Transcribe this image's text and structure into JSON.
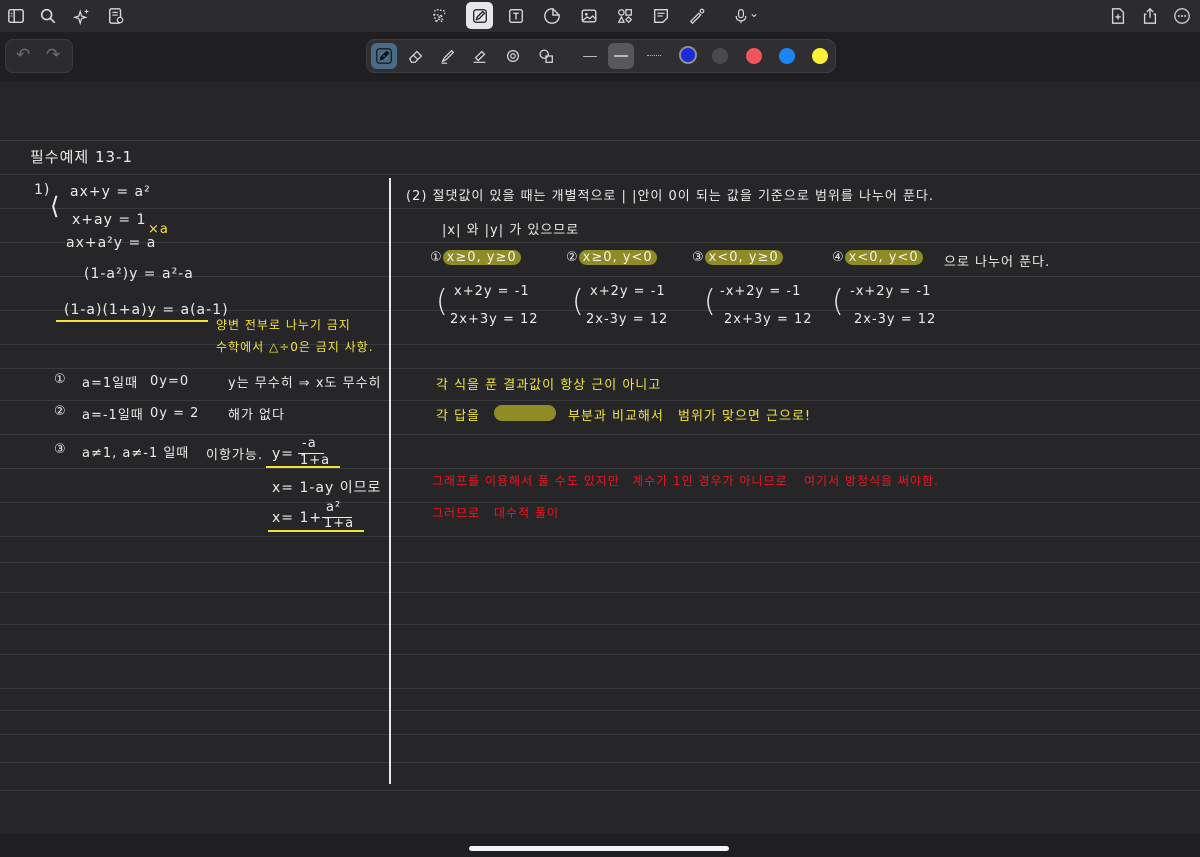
{
  "toolbar": {
    "left_icons": [
      "sidebar-icon",
      "search-icon",
      "sparkle-icon",
      "document-settings-icon"
    ],
    "center_icons": [
      "lasso-icon",
      "pen-icon",
      "text-box-icon",
      "sticker-icon",
      "image-icon",
      "shapes-icon",
      "sticky-note-icon",
      "laser-pointer-icon",
      "microphone-icon"
    ],
    "right_icons": [
      "add-page-icon",
      "share-icon",
      "more-icon"
    ],
    "mic_chevron": "⌄"
  },
  "undo": {
    "undo_glyph": "↶",
    "redo_glyph": "↷"
  },
  "pen_tools": {
    "items": [
      "fountain-pen-icon",
      "eraser-icon",
      "highlighter-icon",
      "marker-icon",
      "spot-icon",
      "shape-eraser-icon"
    ],
    "colors": [
      "#1a2bd8",
      "#4a4a4c",
      "#f0555a",
      "#1a86f5",
      "#fbef3a"
    ]
  },
  "note": {
    "title": "필수예제 13-1",
    "left": {
      "label_1": "1)",
      "eq1": "ax+y = a²",
      "eq2": "x+ay = 1",
      "times_a": "×a",
      "eq3": "ax+a²y = a",
      "eq4": "(1-a²)y = a²-a",
      "eq5": "(1-a)(1+a)y = a(a-1)",
      "note1": "양변 전부로 나누기 금지",
      "note2": "수학에서 △÷0은 금지 사항.",
      "case1_num": "①",
      "case1": "a=1일때",
      "case1_b": "0y=0",
      "case1_c": "y는 무수히 ⇒ x도 무수히",
      "case2_num": "②",
      "case2": "a=-1일때",
      "case2_b": "0y = 2",
      "case2_c": "해가 없다",
      "case3_num": "③",
      "case3": "a≠1, a≠-1 일때",
      "case3_b": "이항가능.",
      "sol_y_lhs": "y=",
      "sol_y_num": "-a",
      "sol_y_den": "1+a",
      "sol_x1": "x= 1-ay 이므로",
      "sol_x2_lhs": "x= 1+",
      "sol_x2_num": "a²",
      "sol_x2_den": "1+a"
    },
    "right": {
      "line1": "(2) 절댓값이 있을 때는 개별적으로 | |안이 0이 되는 값을 기준으로 범위를 나누어 푼다.",
      "line2": "|x| 와 |y| 가 있으므로",
      "case_labels": [
        {
          "num": "①",
          "cond": "x≥0, y≥0"
        },
        {
          "num": "②",
          "cond": "x≥0, y<0"
        },
        {
          "num": "③",
          "cond": "x<0, y≥0"
        },
        {
          "num": "④",
          "cond": "x<0, y<0"
        }
      ],
      "case_tail": "으로 나누어 푼다.",
      "systems": [
        {
          "a": "x+2y = -1",
          "b": "2x+3y = 12"
        },
        {
          "a": "x+2y = -1",
          "b": "2x-3y = 12"
        },
        {
          "a": "-x+2y = -1",
          "b": "2x+3y = 12"
        },
        {
          "a": "-x+2y = -1",
          "b": "2x-3y = 12"
        }
      ],
      "yellow1": "각 식을 푼 결과값이 항상 근이 아니고",
      "yellow2_a": "각 답을",
      "yellow2_b": "부분과 비교해서",
      "yellow2_c": "범위가 맞으면 근으로!",
      "red1_a": "그래프를 이용해서 풀 수도 있지만",
      "red1_b": "계수가 1인 경우가 아니므로",
      "red1_c": "여기서 방정식을 써야함.",
      "red2_a": "그러므로",
      "red2_b": "대수적 풀이"
    }
  }
}
